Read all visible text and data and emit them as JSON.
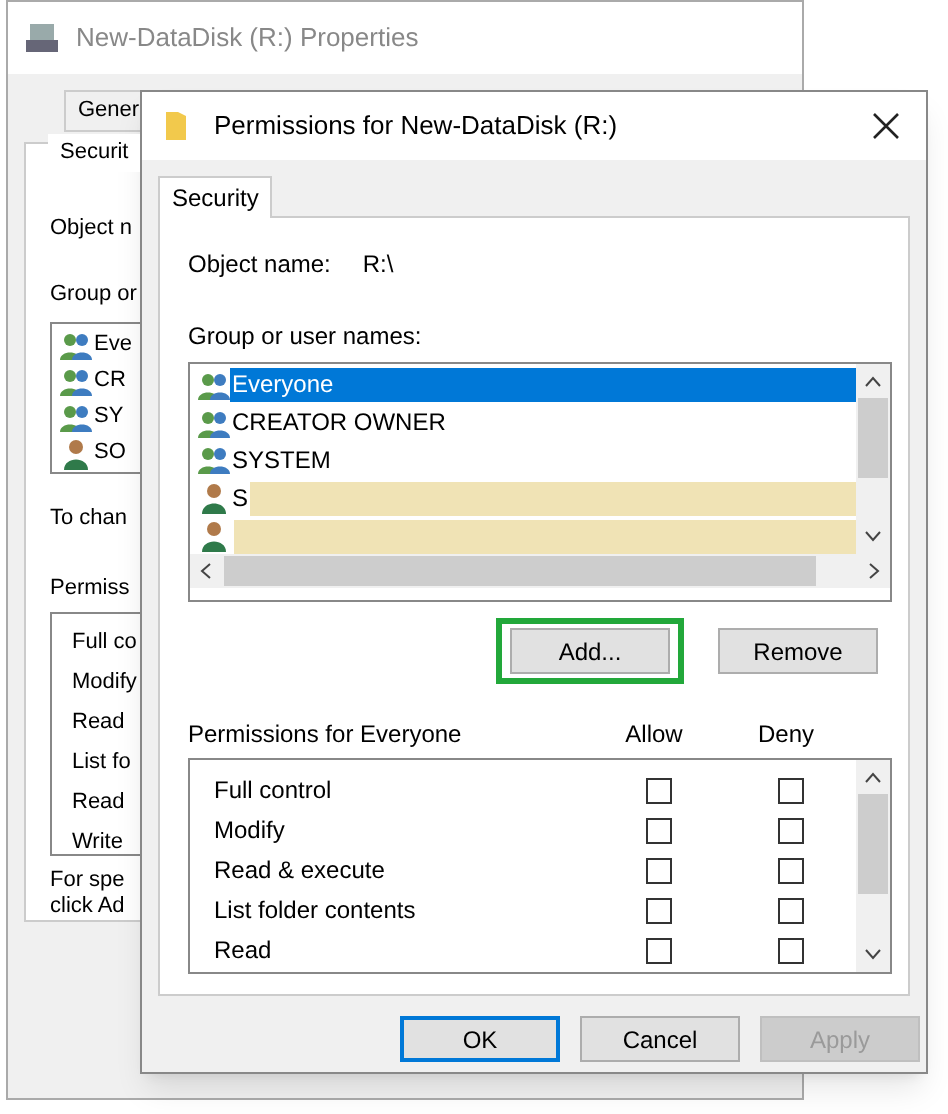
{
  "back_window": {
    "title": "New-DataDisk (R:) Properties",
    "tabs": [
      {
        "label": "Gener",
        "selected": false
      },
      {
        "label": "Securit",
        "selected": true
      }
    ],
    "object_name_label": "Object n",
    "group_label": "Group or",
    "group_items": [
      {
        "name": "Eve",
        "kind": "group"
      },
      {
        "name": "CR",
        "kind": "group"
      },
      {
        "name": "SY",
        "kind": "group"
      },
      {
        "name": "SO",
        "kind": "user"
      }
    ],
    "change_text": "To chan",
    "permissions_label": "Permiss",
    "permissions": [
      "Full co",
      "Modify",
      "Read",
      "List fo",
      "Read",
      "Write"
    ],
    "special_text": [
      "For spe",
      "click Ad"
    ]
  },
  "dialog": {
    "title": "Permissions for New-DataDisk (R:)",
    "tabs": [
      {
        "label": "Security",
        "selected": true
      }
    ],
    "object_name_label": "Object name:",
    "object_name": "R:\\",
    "group_label": "Group or user names:",
    "users": [
      {
        "name": "Everyone",
        "kind": "group",
        "selected": true,
        "redacted": false
      },
      {
        "name": "CREATOR OWNER",
        "kind": "group",
        "selected": false,
        "redacted": false
      },
      {
        "name": "SYSTEM",
        "kind": "group",
        "selected": false,
        "redacted": false
      },
      {
        "name": "S",
        "kind": "user",
        "selected": false,
        "redacted": true
      },
      {
        "kind": "user",
        "selected": false,
        "redacted": true
      }
    ],
    "buttons": [
      {
        "label": "Add...",
        "highlighted": true
      },
      {
        "label": "Remove",
        "highlighted": false
      }
    ],
    "permissions_label": "Permissions for Everyone",
    "columns": [
      "Allow",
      "Deny"
    ],
    "permissions": [
      {
        "name": "Full control",
        "allow": false,
        "deny": false
      },
      {
        "name": "Modify",
        "allow": false,
        "deny": false
      },
      {
        "name": "Read & execute",
        "allow": false,
        "deny": false
      },
      {
        "name": "List folder contents",
        "allow": false,
        "deny": false
      },
      {
        "name": "Read",
        "allow": false,
        "deny": false
      }
    ],
    "footer_buttons": [
      {
        "label": "OK",
        "default": true,
        "disabled": false
      },
      {
        "label": "Cancel",
        "default": false,
        "disabled": false
      },
      {
        "label": "Apply",
        "default": false,
        "disabled": true
      }
    ]
  }
}
